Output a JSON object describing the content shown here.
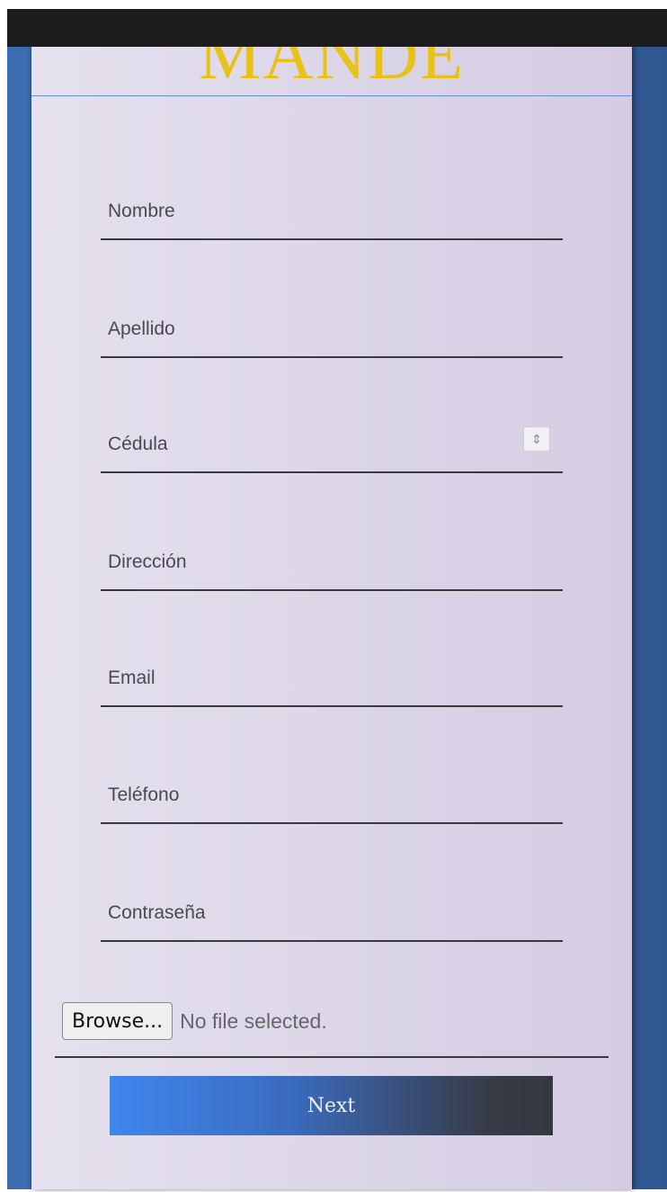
{
  "brand": {
    "title": "MANDE"
  },
  "form": {
    "fields": [
      {
        "placeholder": "Nombre",
        "value": ""
      },
      {
        "placeholder": "Apellido",
        "value": ""
      },
      {
        "placeholder": "Cédula",
        "value": ""
      },
      {
        "placeholder": "Dirección",
        "value": ""
      },
      {
        "placeholder": "Email",
        "value": ""
      },
      {
        "placeholder": "Teléfono",
        "value": ""
      },
      {
        "placeholder": "Contraseña",
        "value": ""
      }
    ],
    "file": {
      "browse_label": "Browse...",
      "status": "No file selected."
    },
    "next_label": "Next"
  },
  "icons": {
    "number_spinner": "spinner-arrows-icon"
  },
  "colors": {
    "brand": "#e8c21a",
    "panel": "#dcd6e8",
    "frame": "#3a6aad",
    "button_start": "#3f86ee",
    "button_end": "#353740"
  }
}
